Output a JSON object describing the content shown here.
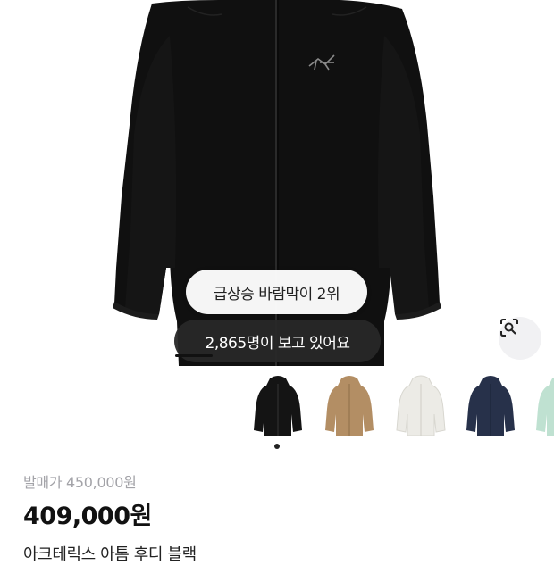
{
  "hero": {
    "image": "black-hooded-jacket-photo",
    "rank_badge": "급상승 바람막이 2위",
    "views_badge": "2,865명이 보고 있어요",
    "lens_icon": "lens-search-icon"
  },
  "thumbnails": [
    {
      "name": "black",
      "color": "#141414"
    },
    {
      "name": "tan",
      "color": "#b38e64"
    },
    {
      "name": "white",
      "color": "#ecebe6"
    },
    {
      "name": "navy",
      "color": "#27314a"
    },
    {
      "name": "mint",
      "color": "#bfe1d1"
    }
  ],
  "price": {
    "original": "발매가 450,000원",
    "sale": "409,000원"
  },
  "product": {
    "title": "아크테릭스 아톰 후디 블랙"
  }
}
